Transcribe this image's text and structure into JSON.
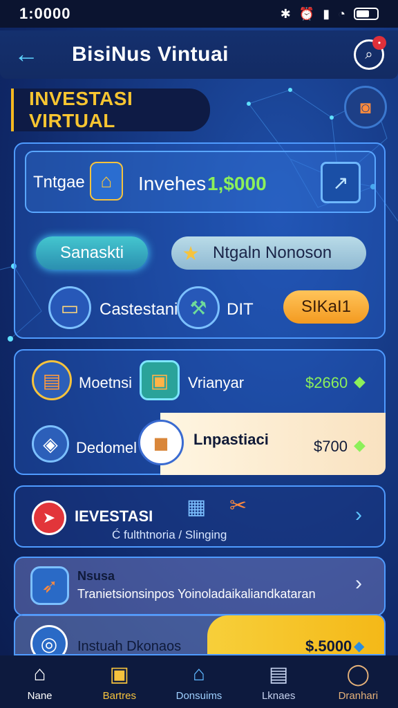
{
  "status_bar": {
    "time": "1:0000"
  },
  "header": {
    "title": "BisiNus Vintuai"
  },
  "banner": {
    "text": "INVESTASI VIRTUAL"
  },
  "investment_card": {
    "label": "Tntgae",
    "invest_label": "Invehes",
    "invest_amount": "1,$000",
    "pill_left": "Sanaskti",
    "pill_right": "Ntgaln Nonoson",
    "item_left_label": "Castestani",
    "item_right_label": "DIT",
    "action_button": "SIKaI1"
  },
  "summary_card": {
    "row1_left": "Moetnsi",
    "row1_right": "Vrianyar",
    "row1_value": "$2660",
    "row2_left": "Dedomel",
    "row2_right": "Lnpastiaci",
    "row2_value": "$700"
  },
  "list": [
    {
      "title": "IEVESTASI",
      "subtitle": "Ć fulthtnoria  /  Slinging"
    },
    {
      "title": "Nsusa",
      "subtitle": "Tranietsionsinpos Yoinoladaikaliandkataran"
    },
    {
      "title": "Instuah Dkonaos",
      "value": "$.5000"
    }
  ],
  "nav": [
    {
      "label": "Nane"
    },
    {
      "label": "Bartres"
    },
    {
      "label": "Donsuims"
    },
    {
      "label": "Lknaes"
    },
    {
      "label": "Dranhari"
    }
  ],
  "colors": {
    "accent": "#5fd3ff",
    "gold": "#f7c531",
    "green": "#8cf05a",
    "orange": "#f5a02a"
  }
}
